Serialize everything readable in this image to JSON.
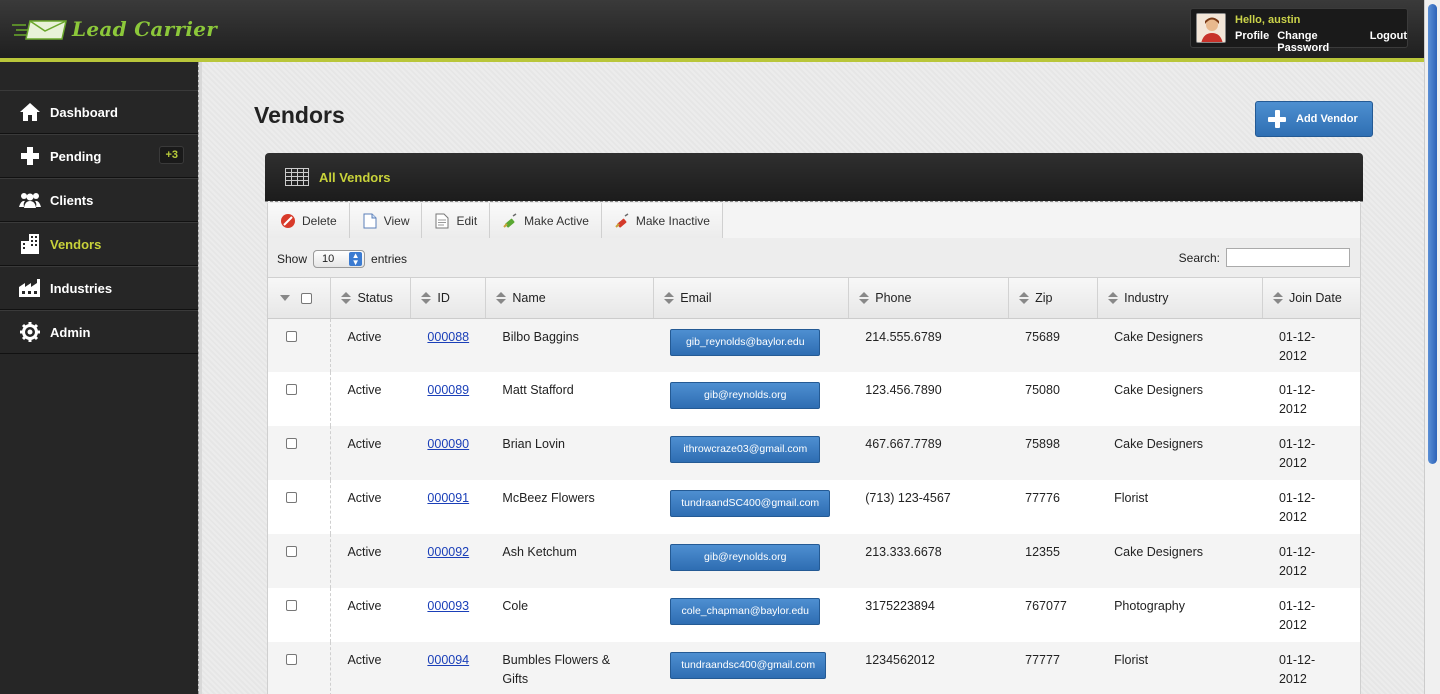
{
  "app": {
    "logo_text": "Lead Carrier"
  },
  "user": {
    "greeting": "Hello, austin",
    "links": [
      "Profile",
      "Change Password",
      "Logout"
    ]
  },
  "sidebar": {
    "items": [
      {
        "label": "Dashboard",
        "icon": "home-icon"
      },
      {
        "label": "Pending",
        "icon": "plus-icon",
        "badge": "+3"
      },
      {
        "label": "Clients",
        "icon": "users-icon"
      },
      {
        "label": "Vendors",
        "icon": "buildings-icon",
        "active": true
      },
      {
        "label": "Industries",
        "icon": "factory-icon"
      },
      {
        "label": "Admin",
        "icon": "gear-icon"
      }
    ]
  },
  "page": {
    "title": "Vendors",
    "add_button": "Add Vendor"
  },
  "panel": {
    "title": "All Vendors"
  },
  "toolbar": {
    "delete": "Delete",
    "view": "View",
    "edit": "Edit",
    "make_active": "Make Active",
    "make_inactive": "Make Inactive"
  },
  "controls": {
    "show_label": "Show",
    "page_size": "10",
    "entries_label": "entries",
    "search_label": "Search:"
  },
  "table": {
    "columns": [
      "Status",
      "ID",
      "Name",
      "Email",
      "Phone",
      "Zip",
      "Industry",
      "Join Date"
    ],
    "rows": [
      {
        "status": "Active",
        "id": "000088",
        "name": "Bilbo Baggins",
        "email": "gib_reynolds@baylor.edu",
        "phone": "214.555.6789",
        "zip": "75689",
        "industry": "Cake Designers",
        "join": "01-12-2012"
      },
      {
        "status": "Active",
        "id": "000089",
        "name": "Matt Stafford",
        "email": "gib@reynolds.org",
        "phone": "123.456.7890",
        "zip": "75080",
        "industry": "Cake Designers",
        "join": "01-12-2012"
      },
      {
        "status": "Active",
        "id": "000090",
        "name": "Brian Lovin",
        "email": "ithrowcraze03@gmail.com",
        "phone": "467.667.7789",
        "zip": "75898",
        "industry": "Cake Designers",
        "join": "01-12-2012"
      },
      {
        "status": "Active",
        "id": "000091",
        "name": "McBeez Flowers",
        "email": "tundraandSC400@gmail.com",
        "phone": "(713) 123-4567",
        "zip": "77776",
        "industry": "Florist",
        "join": "01-12-2012"
      },
      {
        "status": "Active",
        "id": "000092",
        "name": "Ash Ketchum",
        "email": "gib@reynolds.org",
        "phone": "213.333.6678",
        "zip": "12355",
        "industry": "Cake Designers",
        "join": "01-12-2012"
      },
      {
        "status": "Active",
        "id": "000093",
        "name": "Cole",
        "email": "cole_chapman@baylor.edu",
        "phone": "3175223894",
        "zip": "767077",
        "industry": "Photography",
        "join": "01-12-2012"
      },
      {
        "status": "Active",
        "id": "000094",
        "name": "Bumbles Flowers & Gifts",
        "email": "tundraandsc400@gmail.com",
        "phone": "1234562012",
        "zip": "77777",
        "industry": "Florist",
        "join": "01-12-2012"
      }
    ]
  }
}
